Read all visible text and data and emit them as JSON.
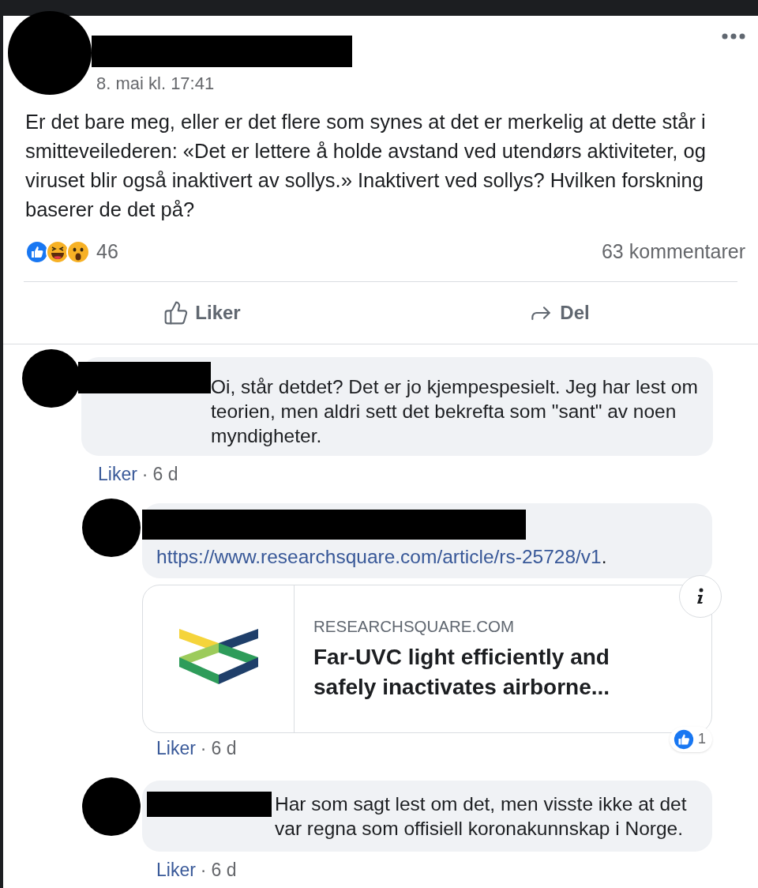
{
  "post": {
    "timestamp": "8. mai kl. 17:41",
    "text": "Er det bare meg, eller er det flere som synes at det er merkelig at dette står i smitteveilederen: «Det er lettere å holde avstand ved utendørs aktiviteter, og viruset blir også inaktivert av sollys.» Inaktivert ved sollys? Hvilken forskning baserer de det på?",
    "reaction_count": "46",
    "comment_count": "63 kommentarer",
    "actions": [
      {
        "label": "Liker",
        "kind": "like"
      },
      {
        "label": "Del",
        "kind": "share"
      }
    ]
  },
  "comments": [
    {
      "text": "Oi, står detdet? Det er jo kjempespesielt. Jeg har lest om teorien, men aldri sett det bekrefta som \"sant\" av noen myndigheter.",
      "like_label": "Liker",
      "separator": "·",
      "age": "6 d",
      "children": [
        {
          "link": "https://www.researchsquare.com/article/rs-25728/v1",
          "link_end": ".",
          "preview": {
            "domain": "RESEARCHSQUARE.COM",
            "title": "Far-UVC light efficiently and safely inactivates airborne..."
          },
          "reaction_count": "1",
          "like_label": "Liker",
          "separator": "·",
          "age": "6 d"
        },
        {
          "text": "Har som sagt lest om det, men visste ikke at det var regna som offisiell koronakunnskap i Norge.",
          "like_label": "Liker",
          "separator": "·",
          "age": "6 d"
        }
      ]
    }
  ]
}
